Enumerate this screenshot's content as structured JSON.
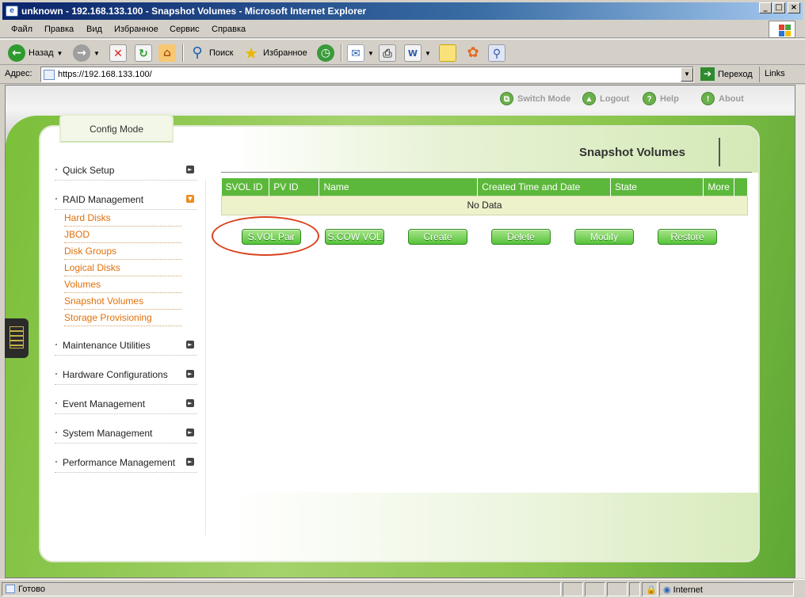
{
  "window": {
    "title": "unknown - 192.168.133.100 - Snapshot Volumes - Microsoft Internet Explorer",
    "buttons": [
      "_",
      "□",
      "×"
    ]
  },
  "menu": [
    "Файл",
    "Правка",
    "Вид",
    "Избранное",
    "Сервис",
    "Справка"
  ],
  "toolbar": {
    "back": "Назад",
    "search": "Поиск",
    "favorites": "Избранное"
  },
  "address": {
    "label": "Адрес:",
    "url": "https://192.168.133.100/",
    "go": "Переход",
    "links": "Links"
  },
  "topnav": [
    {
      "label": "Switch Mode",
      "icon": "switch-mode-icon",
      "glyph": "⧉"
    },
    {
      "label": "Logout",
      "icon": "logout-icon",
      "glyph": "▲"
    },
    {
      "label": "Help",
      "icon": "help-icon",
      "glyph": "?"
    },
    {
      "label": "About",
      "icon": "about-icon",
      "glyph": "!"
    }
  ],
  "config_tab": "Config Mode",
  "sidebar": {
    "quick_setup": "Quick Setup",
    "raid_management": "RAID Management",
    "raid_items": [
      "Hard Disks",
      "JBOD",
      "Disk Groups",
      "Logical Disks",
      "Volumes",
      "Snapshot Volumes",
      "Storage Provisioning"
    ],
    "maintenance": "Maintenance Utilities",
    "hardware": "Hardware Configurations",
    "event": "Event Management",
    "system": "System Management",
    "performance": "Performance Management"
  },
  "content": {
    "title": "Snapshot Volumes",
    "columns": [
      "SVOL ID",
      "PV ID",
      "Name",
      "Created Time and Date",
      "State",
      "More"
    ],
    "empty": "No Data",
    "buttons": [
      "S.VOL Pair",
      "S.COW VOL",
      "Create",
      "Delete",
      "Modify",
      "Restore"
    ]
  },
  "status": {
    "ready": "Готово",
    "zone": "Internet"
  }
}
